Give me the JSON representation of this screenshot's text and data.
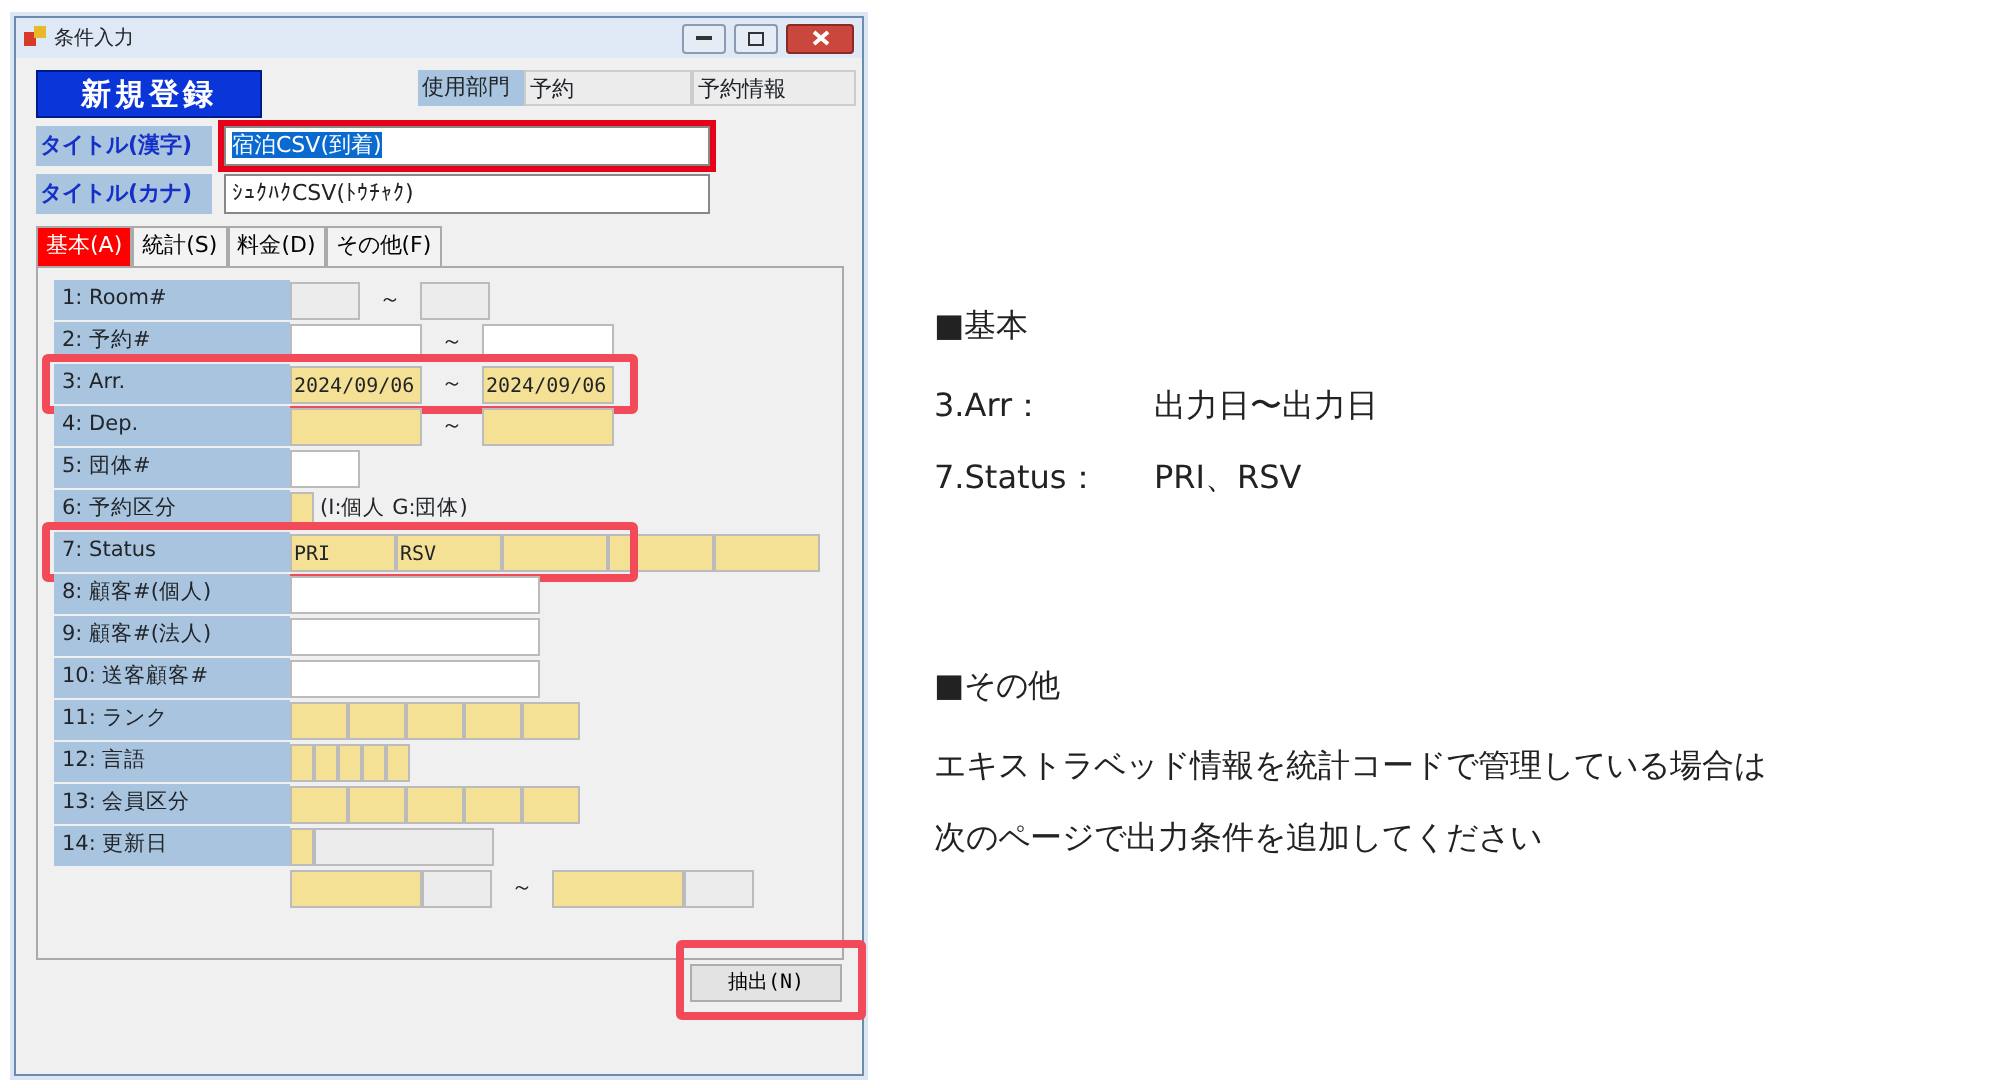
{
  "window": {
    "title": "条件入力"
  },
  "header": {
    "mode_label": "新規登録",
    "dept_label": "使用部門",
    "dept_value": "予約",
    "dept_name": "予約情報"
  },
  "titles": [
    {
      "label": "タイトル(漢字)",
      "value": "宿泊CSV(到着)",
      "selected": true,
      "highlighted": true
    },
    {
      "label": "タイトル(カナ)",
      "value": "ｼｭｸﾊｸCSV(ﾄｳﾁｬｸ)",
      "selected": false,
      "highlighted": false
    }
  ],
  "tabs": [
    {
      "label": "基本(A)",
      "selected": true
    },
    {
      "label": "統計(S)",
      "selected": false
    },
    {
      "label": "料金(D)",
      "selected": false
    },
    {
      "label": "その他(F)",
      "selected": false
    }
  ],
  "rows": [
    {
      "label": "1:  Room#",
      "highlighted": false,
      "parts": [
        {
          "kind": "short",
          "color": "#ececec"
        },
        {
          "kind": "separator",
          "text": "～"
        },
        {
          "kind": "short",
          "color": "#ececec"
        }
      ]
    },
    {
      "label": "2:  予約#",
      "highlighted": false,
      "parts": [
        {
          "kind": "medium",
          "color": "#ffffff"
        },
        {
          "kind": "separator",
          "text": "～"
        },
        {
          "kind": "medium",
          "color": "#ffffff"
        }
      ]
    },
    {
      "label": "3:  Arr.",
      "highlighted": true,
      "parts": [
        {
          "kind": "medium",
          "color": "#f5e195",
          "value": "2024/09/06"
        },
        {
          "kind": "separator",
          "text": "～"
        },
        {
          "kind": "medium",
          "color": "#f5e195",
          "value": "2024/09/06"
        }
      ]
    },
    {
      "label": "4:  Dep.",
      "highlighted": false,
      "parts": [
        {
          "kind": "medium",
          "color": "#f5e195"
        },
        {
          "kind": "separator",
          "text": "～"
        },
        {
          "kind": "medium",
          "color": "#f5e195"
        }
      ]
    },
    {
      "label": "5:  団体#",
      "highlighted": false,
      "parts": [
        {
          "kind": "short",
          "color": "#ffffff"
        }
      ]
    },
    {
      "label": "6:  予約区分",
      "highlighted": false,
      "parts": [
        {
          "kind": "tiny",
          "color": "#f5e195"
        },
        {
          "kind": "note",
          "text": "(I:個人  G:団体)"
        }
      ]
    },
    {
      "label": "7:  Status",
      "highlighted": true,
      "parts": [
        {
          "kind": "slot",
          "color": "#f5e195",
          "value": "PRI"
        },
        {
          "kind": "slot",
          "color": "#f5e195",
          "value": "RSV"
        },
        {
          "kind": "slot",
          "color": "#f5e195"
        },
        {
          "kind": "slot",
          "color": "#f5e195"
        },
        {
          "kind": "slot",
          "color": "#f5e195"
        }
      ]
    },
    {
      "label": "8:  顧客#(個人)",
      "highlighted": false,
      "parts": [
        {
          "kind": "long",
          "color": "#ffffff"
        }
      ]
    },
    {
      "label": "9:  顧客#(法人)",
      "highlighted": false,
      "parts": [
        {
          "kind": "long",
          "color": "#ffffff"
        }
      ]
    },
    {
      "label": "10:  送客顧客#",
      "highlighted": false,
      "parts": [
        {
          "kind": "long",
          "color": "#ffffff"
        }
      ]
    },
    {
      "label": "11:  ランク",
      "highlighted": false,
      "parts": [
        {
          "kind": "cell",
          "color": "#f5e195"
        },
        {
          "kind": "cell",
          "color": "#f5e195"
        },
        {
          "kind": "cell",
          "color": "#f5e195"
        },
        {
          "kind": "cell",
          "color": "#f5e195"
        },
        {
          "kind": "cell",
          "color": "#f5e195"
        }
      ]
    },
    {
      "label": "12:  言語",
      "highlighted": false,
      "parts": [
        {
          "kind": "tiny",
          "color": "#f5e195"
        },
        {
          "kind": "tiny",
          "color": "#f5e195"
        },
        {
          "kind": "tiny",
          "color": "#f5e195"
        },
        {
          "kind": "tiny",
          "color": "#f5e195"
        },
        {
          "kind": "tiny",
          "color": "#f5e195"
        }
      ]
    },
    {
      "label": "13:  会員区分",
      "highlighted": false,
      "parts": [
        {
          "kind": "cell",
          "color": "#f5e195"
        },
        {
          "kind": "cell",
          "color": "#f5e195"
        },
        {
          "kind": "cell",
          "color": "#f5e195"
        },
        {
          "kind": "cell",
          "color": "#f5e195"
        },
        {
          "kind": "cell",
          "color": "#f5e195"
        }
      ]
    },
    {
      "label": "14:  更新日",
      "highlighted": false,
      "parts": [
        {
          "kind": "tiny",
          "color": "#f5e195"
        },
        {
          "kind": "wide",
          "color": "#ececec"
        }
      ]
    },
    {
      "highlighted": false,
      "parts": [
        {
          "kind": "medium",
          "color": "#f5e195"
        },
        {
          "kind": "short",
          "color": "#ececec"
        },
        {
          "kind": "separator",
          "text": "～"
        },
        {
          "kind": "medium",
          "color": "#f5e195"
        },
        {
          "kind": "short",
          "color": "#ececec"
        }
      ]
    }
  ],
  "action_button": {
    "label": "抽出(N)",
    "highlighted": true
  },
  "notes": [
    {
      "kind": "heading",
      "text": "■基本"
    },
    {
      "kind": "item",
      "term": "3.Arr：",
      "text": "出力日〜出力日"
    },
    {
      "kind": "item",
      "term": "7.Status：",
      "text": "PRI、RSV"
    },
    {
      "kind": "heading",
      "text": "■その他"
    },
    {
      "kind": "para",
      "text": "エキストラベッド情報を統計コードで管理している場合は"
    },
    {
      "kind": "para",
      "text": "次のページで出力条件を追加してください"
    }
  ]
}
